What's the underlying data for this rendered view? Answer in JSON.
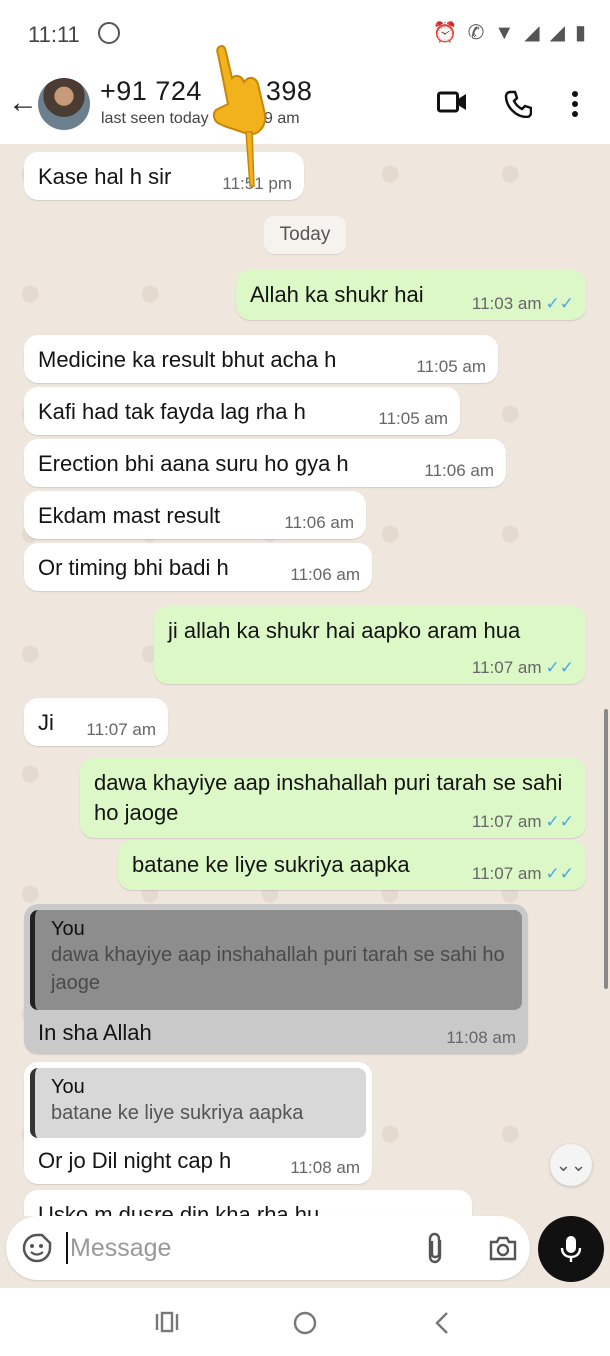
{
  "status_bar": {
    "time": "11:11"
  },
  "header": {
    "contact": "+91 7247 ___ 398",
    "contact_visible": "+91 724",
    "contact_suffix": "398",
    "last_seen": "last seen today",
    "last_seen_suffix": ":09 am"
  },
  "chat": {
    "date_chip": "Today",
    "messages": [
      {
        "dir": "in",
        "text": "Kase hal h sir",
        "time": "11:51 pm"
      },
      {
        "dir": "out",
        "text": "Allah ka shukr hai",
        "time": "11:03 am"
      },
      {
        "dir": "in",
        "text": "Medicine ka result bhut acha h",
        "time": "11:05 am"
      },
      {
        "dir": "in",
        "text": "Kafi had tak fayda lag rha h",
        "time": "11:05 am"
      },
      {
        "dir": "in",
        "text": "Erection bhi aana suru ho gya h",
        "time": "11:06 am"
      },
      {
        "dir": "in",
        "text": "Ekdam mast result",
        "time": "11:06 am"
      },
      {
        "dir": "in",
        "text": "Or timing bhi badi h",
        "time": "11:06 am"
      },
      {
        "dir": "out",
        "text": "ji allah ka shukr hai aapko aram hua",
        "time": "11:07 am"
      },
      {
        "dir": "in",
        "text": "Ji",
        "time": "11:07 am"
      },
      {
        "dir": "out",
        "text": "dawa khayiye aap inshahallah puri tarah se sahi ho jaoge",
        "time": "11:07 am"
      },
      {
        "dir": "out",
        "text": "batane ke liye sukriya aapka",
        "time": "11:07 am"
      },
      {
        "dir": "in",
        "quote_author": "You",
        "quote_text": "dawa khayiye aap inshahallah puri tarah se sahi ho jaoge",
        "text": "In sha Allah",
        "time": "11:08 am"
      },
      {
        "dir": "in",
        "quote_author": "You",
        "quote_text": "batane ke liye sukriya aapka",
        "text": "Or jo Dil night cap h",
        "time": "11:08 am"
      },
      {
        "dir": "in",
        "text": "Usko m dusre din kha rha hu",
        "time": ""
      }
    ],
    "read_ticks": "✓✓"
  },
  "composer": {
    "placeholder": "Message"
  },
  "colors": {
    "incoming": "#ffffff",
    "outgoing": "#dcf8c6",
    "ticks": "#4fa6e6",
    "background": "#efe7de"
  }
}
